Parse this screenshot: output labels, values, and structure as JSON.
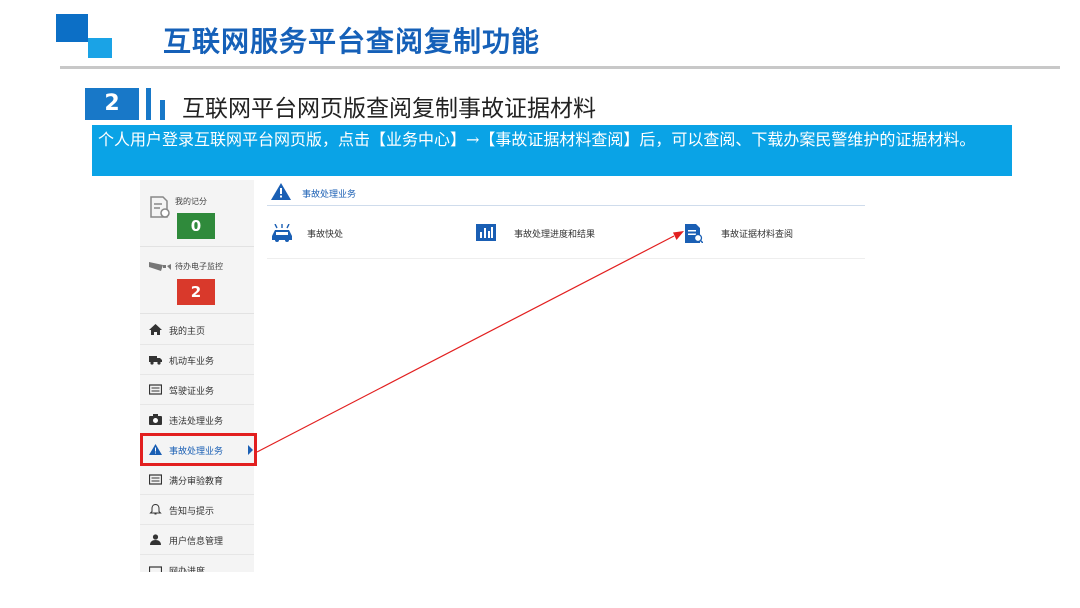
{
  "slide": {
    "title": "互联网服务平台查阅复制功能",
    "section_number": "2",
    "section_title": "互联网平台网页版查阅复制事故证据材料",
    "description": "个人用户登录互联网平台网页版，点击【业务中心】→【事故证据材料查阅】后，可以查阅、下载办案民警维护的证据材料。"
  },
  "sidebar": {
    "stats": [
      {
        "label": "我的记分",
        "value": "0",
        "color": "#2f8a3b",
        "icon": "document-icon"
      },
      {
        "label": "待办电子监控",
        "value": "2",
        "color": "#d9392b",
        "icon": "camera-icon"
      }
    ],
    "items": [
      {
        "label": "我的主页",
        "icon": "home-icon"
      },
      {
        "label": "机动车业务",
        "icon": "truck-icon"
      },
      {
        "label": "驾驶证业务",
        "icon": "license-icon"
      },
      {
        "label": "违法处理业务",
        "icon": "camera-icon"
      },
      {
        "label": "事故处理业务",
        "icon": "warning-icon",
        "active": true
      },
      {
        "label": "满分审验教育",
        "icon": "list-icon"
      },
      {
        "label": "告知与提示",
        "icon": "bell-icon"
      },
      {
        "label": "用户信息管理",
        "icon": "user-icon"
      },
      {
        "label": "网办进度",
        "icon": "progress-icon"
      }
    ]
  },
  "content": {
    "header": "事故处理业务",
    "services": [
      {
        "label": "事故快处",
        "icon": "car-crash-icon"
      },
      {
        "label": "事故处理进度和结果",
        "icon": "bar-chart-icon"
      },
      {
        "label": "事故证据材料查阅",
        "icon": "evidence-doc-icon"
      }
    ]
  },
  "colors": {
    "brand_blue": "#1560b8",
    "accent_cyan": "#0aa3e6",
    "highlight_red": "#e21f1f"
  }
}
